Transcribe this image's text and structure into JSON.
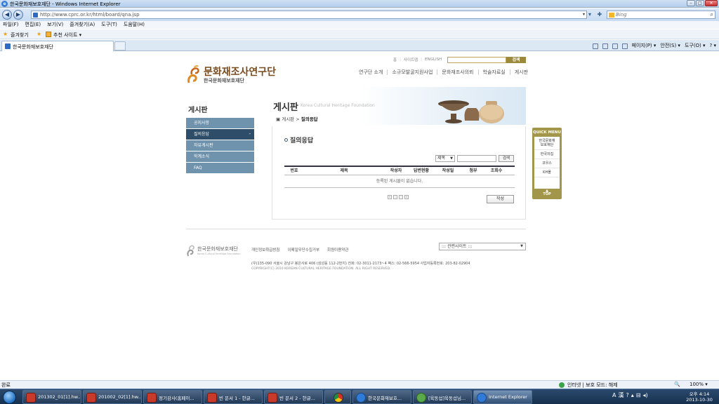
{
  "window": {
    "title": "한국문화재보호재단 - Windows Internet Explorer",
    "buttons": {
      "minimize": "–",
      "maximize": "□",
      "close": "✕"
    }
  },
  "address_bar": {
    "back": "◀",
    "forward": "▶",
    "url": "http://www.cprc.or.kr/html/board/qna.jsp",
    "tools": "▾ ✚ ✕",
    "search_placeholder": "Bing",
    "search_icon": "⌕"
  },
  "menu": [
    "파일(F)",
    "편집(E)",
    "보기(V)",
    "즐겨찾기(A)",
    "도구(T)",
    "도움말(H)"
  ],
  "favorites_bar": {
    "favorites_label": "즐겨찾기",
    "suggested_sites": "추천 사이트 ▾"
  },
  "tab": {
    "label": "한국문화재보호재단"
  },
  "command_bar": {
    "page": "페이지(P) ▾",
    "safety": "안전(S) ▾",
    "tools": "도구(O) ▾",
    "help": "? ▾"
  },
  "site": {
    "util_links": [
      "홈",
      "|",
      "사이트맵",
      "|",
      "ENGLISH"
    ],
    "util_search_button": "검색",
    "logo_main": "문화재조사연구단",
    "logo_sub": "한국문화재보호재단",
    "gnb": [
      "연구단 소개",
      "소규모발굴지원사업",
      "문화재조사의뢰",
      "학술자료실",
      "게시판"
    ],
    "lnb_title": "게시판",
    "lnb_items": [
      "공지사항",
      "질의응답",
      "자유게시판",
      "학계소식",
      "FAQ"
    ],
    "lnb_active_marker": "-",
    "header_title": "게시판",
    "header_eng": "Korea Cultural Heritage Foundation",
    "breadcrumb_home": "▣ 게시판 > ",
    "breadcrumb_current": "질의응답",
    "board_title": "질의응답",
    "search_select": "제목",
    "search_button": "검색",
    "table_headers": [
      "번호",
      "제목",
      "작성자",
      "답변현황",
      "작성일",
      "첨부",
      "조회수"
    ],
    "empty_message": "등록된 게시물이 없습니다.",
    "paging": [
      "«",
      "‹",
      "›",
      "»"
    ],
    "write_button": "작성",
    "quick_menu": {
      "title": "QUICK MENU",
      "items": [
        "한국문화재\n보호재단",
        "한국의집",
        "코우스",
        "KH몰"
      ],
      "top": "▲\nTOP"
    },
    "footer": {
      "logo_main": "한국문화재보호재단",
      "logo_sub": "Korea Cultural Heritage Foundation",
      "links": [
        "개인정보취급방침",
        "이메일무단수집거부",
        "회원이용약관"
      ],
      "related_sites": "::: 관련사이트 :::",
      "address": "(우)135-090 서울시 강남구 봉은사로 406 (삼성동 112-2번지)  전화: 02-3011-2173~4  팩스: 02-566-5954  사업자등록번호: 203-82-02904",
      "copyright": "COPYRIGHT(C) 2010 KOREAN CULTURAL HERITAGE FOUNDATION. ALL RIGHT RESERVED."
    }
  },
  "status_bar": {
    "status": "완료",
    "zone": "인터넷 | 보호 모드: 해제",
    "zoom": "100% ▾",
    "zoom_icon": "🔍"
  },
  "taskbar": {
    "tasks": [
      {
        "label": "201302_01[1].hw...",
        "icon": "hwp"
      },
      {
        "label": "201002_02[1].hw...",
        "icon": "hwp"
      },
      {
        "label": "정기감사(홈페이...",
        "icon": "hwp"
      },
      {
        "label": "빈 문서 1 - 한글...",
        "icon": "hwp"
      },
      {
        "label": "빈 문서 2 - 한글...",
        "icon": "hwp"
      },
      {
        "label": "",
        "icon": "chrome"
      },
      {
        "label": "한국문화재보호...",
        "icon": "ie"
      },
      {
        "label": "[육동섭]육동섭님...",
        "icon": "msg"
      },
      {
        "label": "Internet Explorer",
        "icon": "ie"
      }
    ],
    "tray": [
      "A",
      "漢",
      "?",
      "▴",
      "⊟",
      "◂)"
    ],
    "clock_time": "오후 4:14",
    "clock_date": "2013-10-30"
  }
}
